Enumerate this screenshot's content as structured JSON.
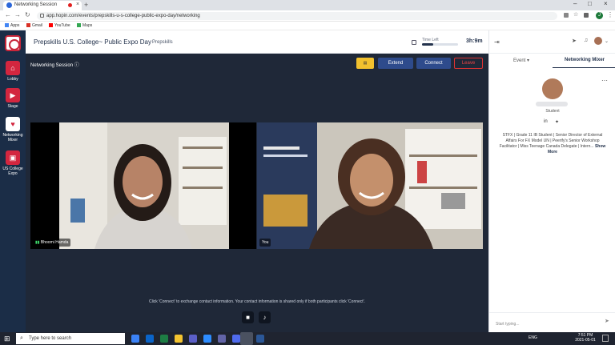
{
  "browser": {
    "tab_title": "Networking Session",
    "url": "app.hopin.com/events/prepskills-u-s-college-public-expo-day/networking",
    "bookmarks": [
      "Apps",
      "Gmail",
      "YouTube",
      "Maps"
    ],
    "profile_initial": "J"
  },
  "sidebar": {
    "items": [
      {
        "label": "Lobby"
      },
      {
        "label": "Stage"
      },
      {
        "label": "Networking Mixer"
      },
      {
        "label": "US College Expo"
      }
    ]
  },
  "header": {
    "event_title": "Prepskills U.S. College~ Public Expo Day",
    "organizer": "Prepskills",
    "time_left_label": "Time Left",
    "time_left_value": "3h:9m",
    "time_left_fraction": 0.3
  },
  "session": {
    "title": "Networking Session",
    "buttons": {
      "extend": "Extend",
      "connect": "Connect",
      "leave": "Leave"
    },
    "participants": [
      {
        "name": "Bhoomi Hamda"
      },
      {
        "name": "You"
      }
    ],
    "info_text": "Click 'Connect' to exchange contact information. Your contact information is shared only if both participants click 'Connect'."
  },
  "right_panel": {
    "tabs": [
      "Event",
      "Networking Mixer"
    ],
    "active_tab": "Networking Mixer",
    "profile": {
      "role": "Student",
      "bio": "STFX | Grade 11 IB Student | Senior Director of External Affairs For FX Model UN | Peerify's Senior Workshop Facilitator | Miss Teenage Canada Delegate | Intern...",
      "show_more": "Show More"
    },
    "chat_placeholder": "Start typing..."
  },
  "taskbar": {
    "search_placeholder": "Type here to search",
    "time": "7:51 PM",
    "date": "2021-05-01",
    "lang": "ENG"
  },
  "colors": {
    "nav_bg": "#1b2d47",
    "stage_bg": "#1f2838",
    "accent_red": "#d3263f",
    "button_blue": "#2e4b8c"
  }
}
